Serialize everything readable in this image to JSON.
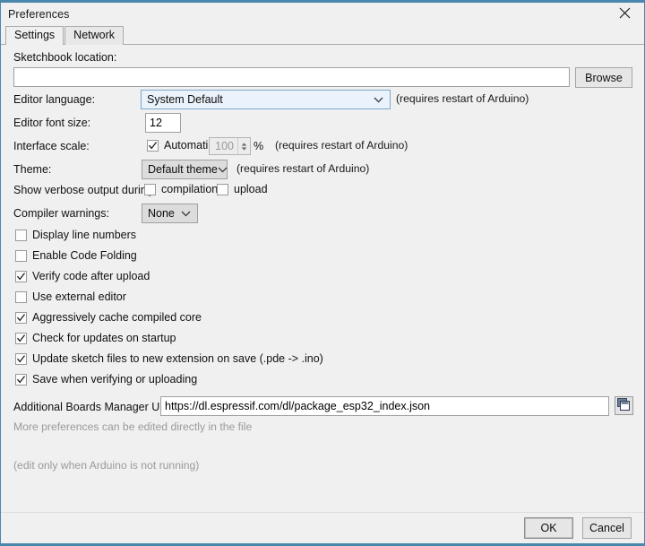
{
  "window": {
    "title": "Preferences",
    "close_icon": "close-icon",
    "accent_color": "#4a87ad",
    "background": "#f0f0f0"
  },
  "tabs": [
    {
      "label": "Settings",
      "active": true
    },
    {
      "label": "Network",
      "active": false
    }
  ],
  "settings": {
    "sketchbook": {
      "label": "Sketchbook location:",
      "value": "",
      "browse_label": "Browse"
    },
    "editor_language": {
      "label": "Editor language:",
      "value": "System Default",
      "note": "(requires restart of Arduino)",
      "chevron_icon": "chevron-down-icon"
    },
    "editor_font_size": {
      "label": "Editor font size:",
      "value": "12"
    },
    "interface_scale": {
      "label": "Interface scale:",
      "automatic_label": "Automatic",
      "automatic_checked": true,
      "scale_value": "100",
      "percent_label": "%",
      "note": "(requires restart of Arduino)",
      "spinner_icon": "spinner-arrows-icon"
    },
    "theme": {
      "label": "Theme:",
      "value": "Default theme",
      "note": "(requires restart of Arduino)",
      "chevron_icon": "chevron-down-icon"
    },
    "verbose_output": {
      "label": "Show verbose output during:",
      "compilation_label": "compilation",
      "compilation_checked": false,
      "upload_label": "upload",
      "upload_checked": false
    },
    "compiler_warnings": {
      "label": "Compiler warnings:",
      "value": "None",
      "chevron_icon": "chevron-down-icon"
    },
    "checkboxes": [
      {
        "label": "Display line numbers",
        "checked": false,
        "name": "display-line-numbers"
      },
      {
        "label": "Enable Code Folding",
        "checked": false,
        "name": "enable-code-folding"
      },
      {
        "label": "Verify code after upload",
        "checked": true,
        "name": "verify-code-after-upload"
      },
      {
        "label": "Use external editor",
        "checked": false,
        "name": "use-external-editor"
      },
      {
        "label": "Aggressively cache compiled core",
        "checked": true,
        "name": "aggressively-cache-compiled-core"
      },
      {
        "label": "Check for updates on startup",
        "checked": true,
        "name": "check-for-updates-on-startup"
      },
      {
        "label": "Update sketch files to new extension on save (.pde -> .ino)",
        "checked": true,
        "name": "update-sketch-files-extension"
      },
      {
        "label": "Save when verifying or uploading",
        "checked": true,
        "name": "save-when-verifying-or-uploading"
      }
    ],
    "boards_manager": {
      "label": "Additional Boards Manager URLs:",
      "value": "https://dl.espressif.com/dl/package_esp32_index.json",
      "expand_icon": "window-copy-icon"
    },
    "more_prefs_text": "More preferences can be edited directly in the file",
    "edit_note_text": "(edit only when Arduino is not running)"
  },
  "footer": {
    "ok_label": "OK",
    "cancel_label": "Cancel"
  }
}
